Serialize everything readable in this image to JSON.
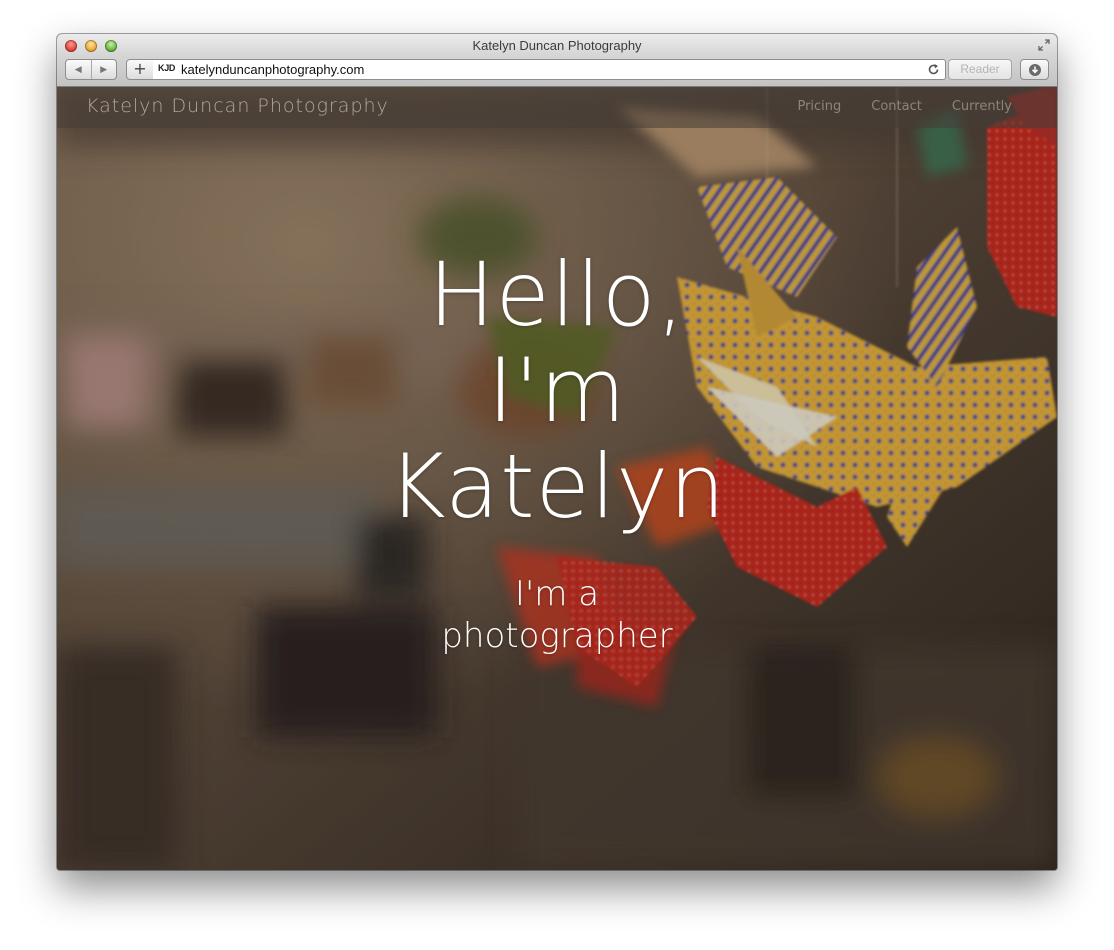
{
  "browser": {
    "window_title": "Katelyn Duncan Photography",
    "favicon_label": "KJD",
    "url": "katelynduncanphotography.com",
    "reader_label": "Reader",
    "icons": [
      "close-icon",
      "minimize-icon",
      "maximize-icon",
      "back-icon",
      "forward-icon",
      "add-bookmark-icon",
      "reload-icon",
      "download-icon",
      "fullscreen-icon"
    ]
  },
  "site": {
    "brand": "Katelyn Duncan Photography",
    "nav": [
      "Pricing",
      "Contact",
      "Currently"
    ],
    "hero": {
      "title_lines": [
        "Hello,",
        "I'm",
        "Katelyn"
      ],
      "subtitle_lines": [
        "I'm a",
        "photographer"
      ]
    }
  },
  "colors": {
    "hero_text": "#ffffff",
    "nav_overlay": "#463e37",
    "crane_yellow": "#e6b23a",
    "crane_red": "#c8281e",
    "crane_blue": "#2c3d9a"
  }
}
